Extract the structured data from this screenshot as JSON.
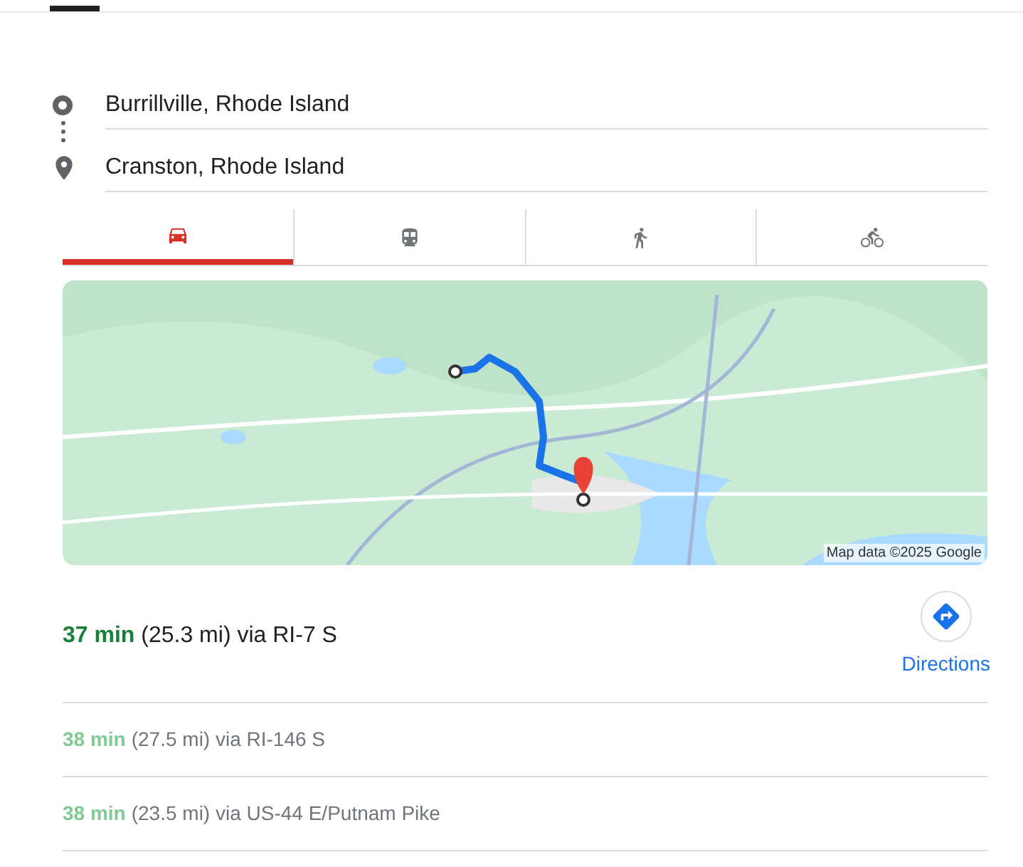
{
  "origin": {
    "value": "Burrillville, Rhode Island"
  },
  "destination": {
    "value": "Cranston, Rhode Island"
  },
  "modes": [
    {
      "kind": "car",
      "selected": true
    },
    {
      "kind": "transit",
      "selected": false
    },
    {
      "kind": "walk",
      "selected": false
    },
    {
      "kind": "bike",
      "selected": false
    }
  ],
  "map": {
    "kind": "picture",
    "attribution": "Map data ©2025 Google"
  },
  "best_route": {
    "time": "37 min",
    "details": "(25.3 mi) via RI-7 S"
  },
  "directions_button": {
    "label": "Directions"
  },
  "alternatives": [
    {
      "time": "38 min",
      "details": "(27.5 mi) via RI-146 S"
    },
    {
      "time": "38 min",
      "details": "(23.5 mi) via US-44 E/Putnam Pike"
    }
  ]
}
